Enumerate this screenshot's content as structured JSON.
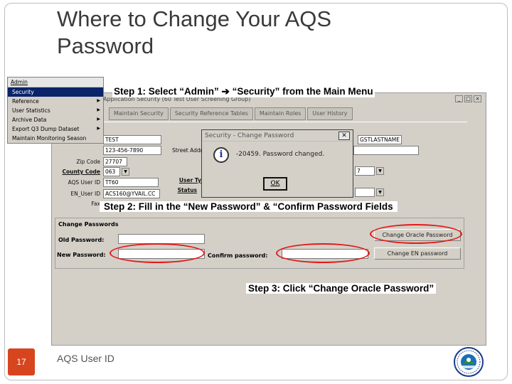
{
  "slide": {
    "title_line1": "Where to Change Your AQS",
    "title_line2": "Password",
    "page_number": "17",
    "footer_text": "AQS User ID"
  },
  "steps": {
    "step1": "Step 1:  Select “Admin” ➔ “Security” from the Main Menu",
    "step2": "Step 2:  Fill in the “New Password” & “Confirm Password Fields",
    "step3": "Step 3:  Click “Change Oracle Password”"
  },
  "app": {
    "window_title": "Application Security (60 Test User Screening Group)",
    "tabs": [
      "Maintain Security",
      "Security Reference Tables",
      "Maintain Roles",
      "User History"
    ],
    "form": {
      "name_value": "TEST",
      "last_name_value": "GSTLASTNAME",
      "phone_value": "123-456-7890",
      "street_label": "Street Address",
      "zip_label": "Zip Code",
      "zip_value": "27707",
      "county_label": "County Code",
      "county_value": "063",
      "aqs_user_label": "AQS User ID",
      "aqs_user_value": "TT60",
      "user_type_label": "User Ty",
      "status_label": "Status",
      "en_user_label": "EN_User ID",
      "en_user_value": "ACS160@YVAIL.CC",
      "fax_label": "Fax",
      "right_value": "7"
    },
    "change_passwords": {
      "header": "Change Passwords",
      "old_label": "Old Password:",
      "new_label": "New Password:",
      "confirm_label": "Confirm password:",
      "oracle_button": "Change Oracle Password",
      "en_button": "Change EN password"
    }
  },
  "menu": {
    "top": "Admin",
    "items": [
      {
        "label": "Security",
        "selected": true,
        "submenu": false
      },
      {
        "label": "Reference",
        "selected": false,
        "submenu": true
      },
      {
        "label": "User Statistics",
        "selected": false,
        "submenu": true
      },
      {
        "label": "Archive Data",
        "selected": false,
        "submenu": true
      },
      {
        "label": "Export Q3 Dump Dataset",
        "selected": false,
        "submenu": true
      },
      {
        "label": "Maintain Monitoring Season",
        "selected": false,
        "submenu": false
      }
    ]
  },
  "dialog": {
    "title": "Security - Change Password",
    "message": "-20459. Password changed.",
    "ok_label": "OK",
    "close_label": "✕"
  },
  "colors": {
    "page_number_bg": "#d7451f",
    "highlight_oval": "#e21a1a",
    "menu_selected": "#0a246a"
  },
  "icons": {
    "dialog": "info-icon",
    "logo": "epa-seal-logo"
  }
}
